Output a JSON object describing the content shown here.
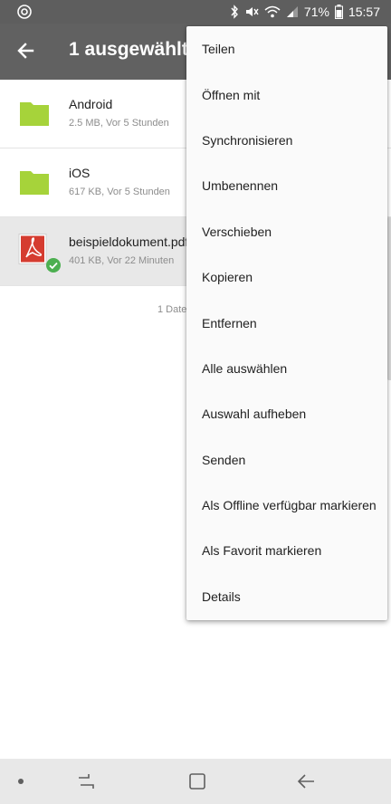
{
  "status_bar": {
    "battery_percent": "71%",
    "time": "15:57",
    "icons": [
      "app-sync-icon",
      "bluetooth-icon",
      "mute-icon",
      "wifi-icon",
      "signal-icon",
      "battery-icon"
    ]
  },
  "app_bar": {
    "title": "1 ausgewählt",
    "back_icon": "arrow-left-icon",
    "background": "#616161"
  },
  "files": [
    {
      "name": "Android",
      "meta": "2.5 MB, Vor 5 Stunden",
      "type": "folder",
      "selected": false,
      "icon_color": "#a6d33a"
    },
    {
      "name": "iOS",
      "meta": "617 KB, Vor 5 Stunden",
      "type": "folder",
      "selected": false,
      "icon_color": "#a6d33a"
    },
    {
      "name": "beispieldokument.pdf",
      "meta": "401 KB, Vor 22 Minuten",
      "type": "pdf",
      "selected": true,
      "icon_color": "#d53c30"
    }
  ],
  "file_count": "1 Date",
  "menu": {
    "items": [
      "Teilen",
      "Öffnen mit",
      "Synchronisieren",
      "Umbenennen",
      "Verschieben",
      "Kopieren",
      "Entfernen",
      "Alle auswählen",
      "Auswahl aufheben",
      "Senden",
      "Als Offline verfügbar markieren",
      "Als Favorit markieren",
      "Details"
    ]
  },
  "nav_bar": {
    "icons": [
      "nav-dot-icon",
      "recents-icon",
      "home-icon",
      "back-icon"
    ]
  },
  "colors": {
    "folder": "#a6d33a",
    "pdf": "#d53c30",
    "check": "#4caf50",
    "selected_row": "#e8e8e8"
  }
}
